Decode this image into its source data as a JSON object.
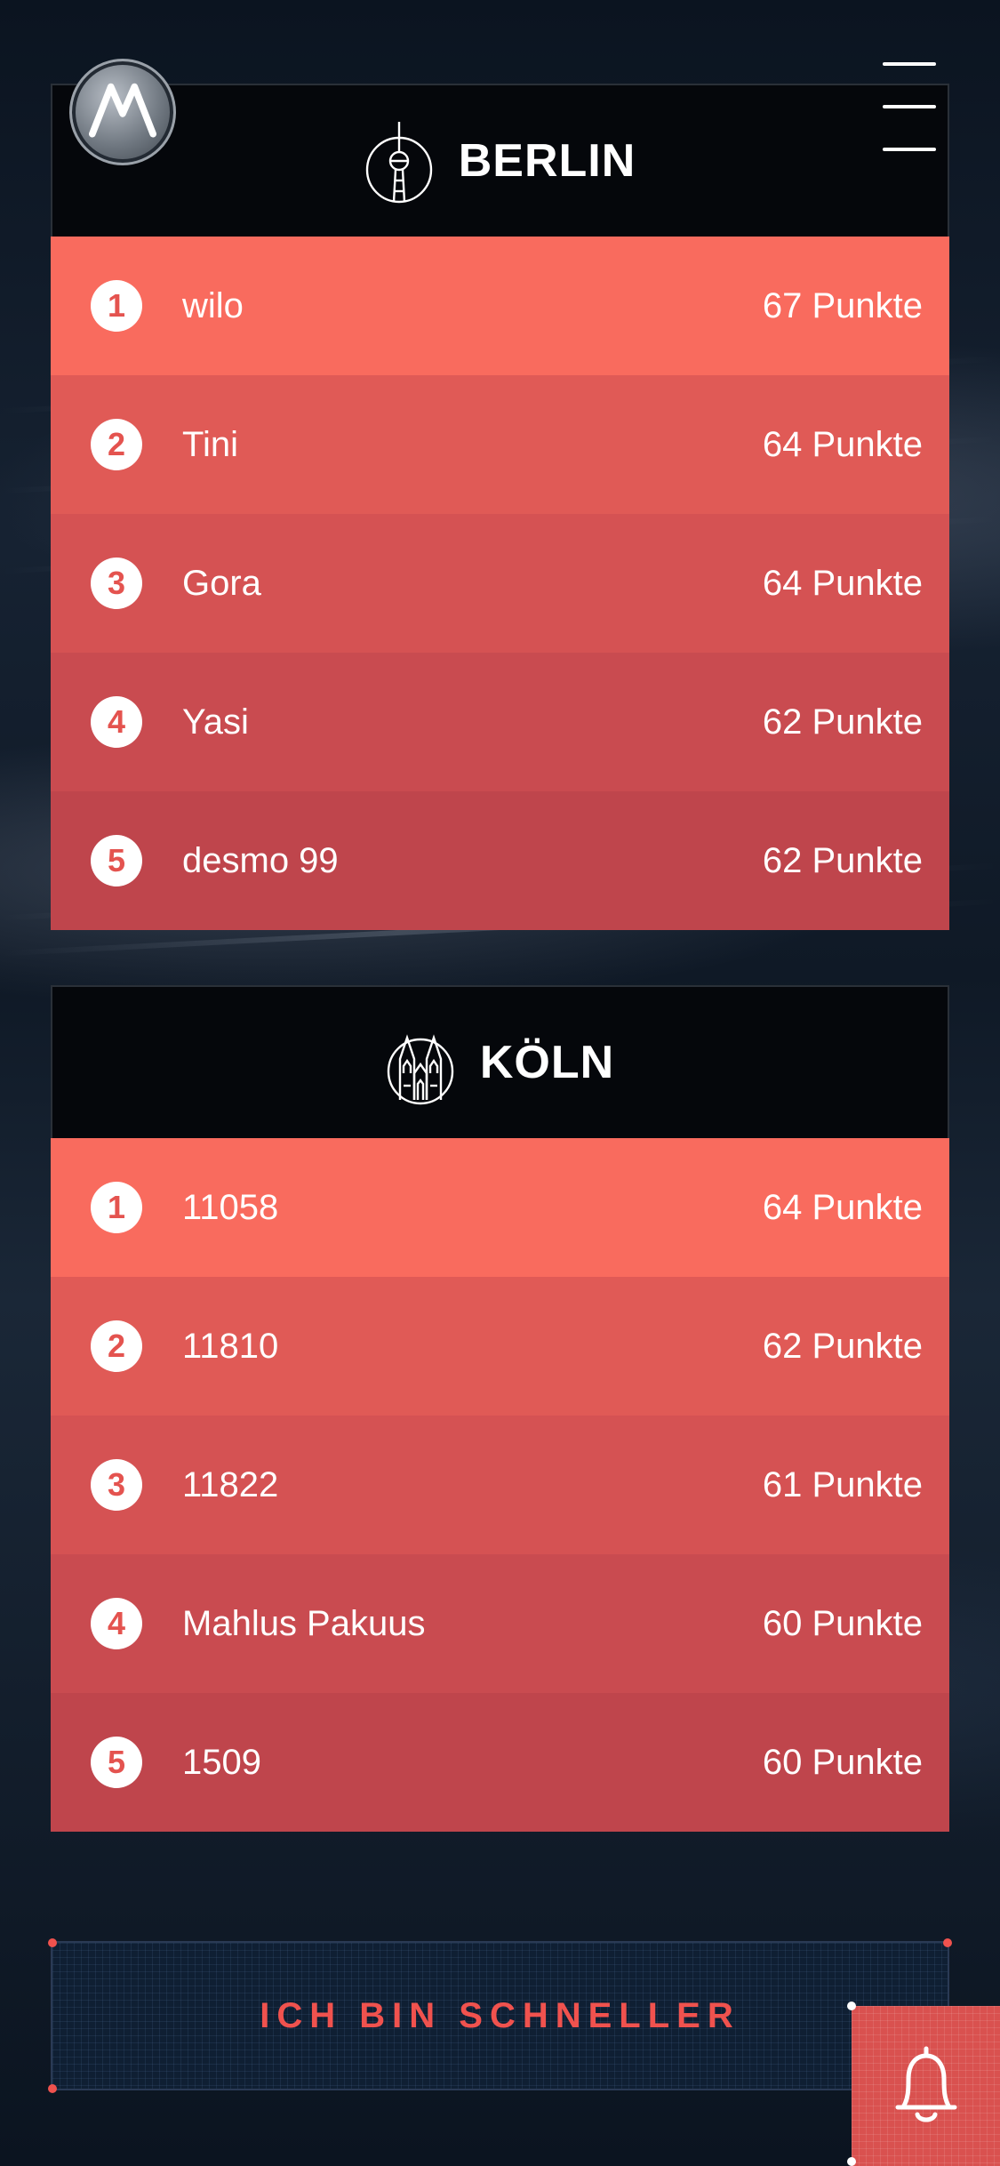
{
  "header": {
    "logo_icon": "motorola-logo-icon",
    "menu_icon": "hamburger-menu-icon"
  },
  "leaderboards": [
    {
      "city": "BERLIN",
      "icon": "tv-tower-icon",
      "entries": [
        {
          "rank": "1",
          "name": "wilo",
          "score": "67 Punkte",
          "color": "#f96b5e"
        },
        {
          "rank": "2",
          "name": "Tini",
          "score": "64 Punkte",
          "color": "#e05a56"
        },
        {
          "rank": "3",
          "name": "Gora",
          "score": "64 Punkte",
          "color": "#d55253"
        },
        {
          "rank": "4",
          "name": "Yasi",
          "score": "62 Punkte",
          "color": "#c94b50"
        },
        {
          "rank": "5",
          "name": "desmo 99",
          "score": "62 Punkte",
          "color": "#bf454c"
        }
      ]
    },
    {
      "city": "KÖLN",
      "icon": "cathedral-icon",
      "entries": [
        {
          "rank": "1",
          "name": "11058",
          "score": "64 Punkte",
          "color": "#f96b5e"
        },
        {
          "rank": "2",
          "name": "11810",
          "score": "62 Punkte",
          "color": "#e05a56"
        },
        {
          "rank": "3",
          "name": "11822",
          "score": "61 Punkte",
          "color": "#d55253"
        },
        {
          "rank": "4",
          "name": "Mahlus Pakuus",
          "score": "60 Punkte",
          "color": "#c94b50"
        },
        {
          "rank": "5",
          "name": "1509",
          "score": "60 Punkte",
          "color": "#bf454c"
        }
      ]
    }
  ],
  "cta": {
    "label": "ICH BIN SCHNELLER"
  },
  "notification": {
    "icon": "bell-icon"
  },
  "colors": {
    "accent": "#f0524e",
    "header_bg": "#05070b"
  }
}
